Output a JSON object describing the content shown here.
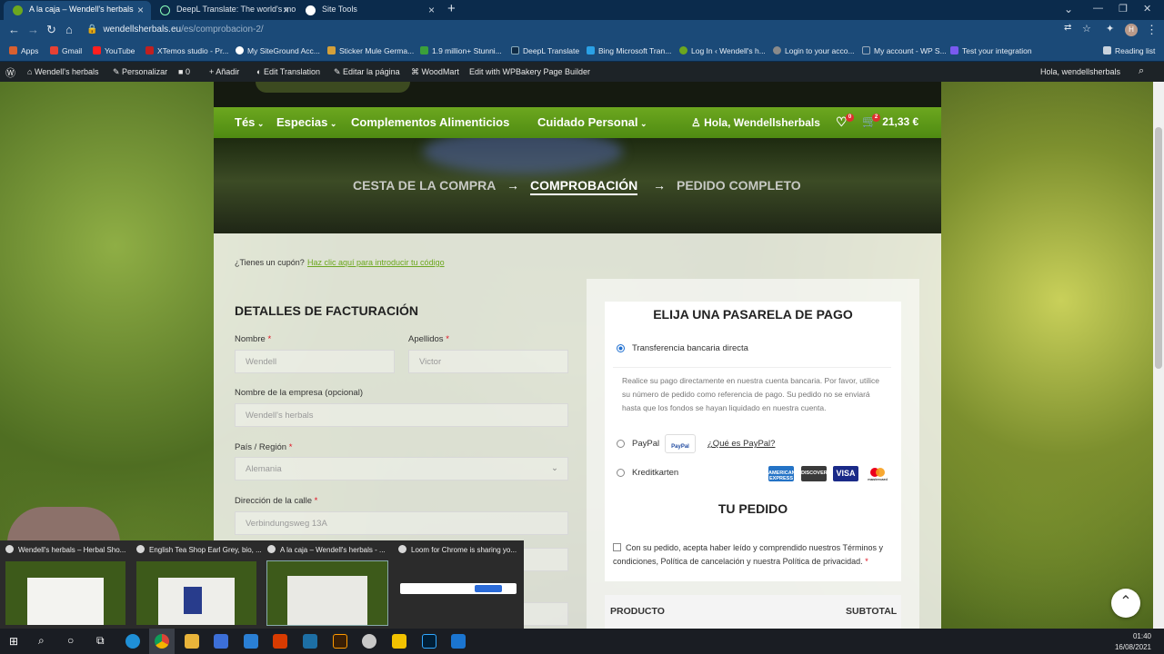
{
  "browser": {
    "tabs": [
      {
        "title": "A la caja – Wendell's herbals"
      },
      {
        "title": "DeepL Translate: The world's mo"
      },
      {
        "title": "Site Tools"
      }
    ],
    "new_tab_icon": "plus-icon",
    "url_host": "wendellsherbals.eu",
    "url_path": "/es/comprobacion-2/",
    "bookmarks": [
      "Apps",
      "Gmail",
      "YouTube",
      "XTemos studio - Pr...",
      "My SiteGround Acc...",
      "Sticker Mule Germa...",
      "1.9 million+ Stunni...",
      "DeepL Translate",
      "Bing Microsoft Tran...",
      "Log In ‹ Wendell's h...",
      "Login to your acco...",
      "My account - WP S...",
      "Test your integration"
    ],
    "reading_list": "Reading list",
    "avatar_letter": "H"
  },
  "adminbar": {
    "site": "Wendell's herbals",
    "customize": "Personalizar",
    "comments": "0",
    "add": "Añadir",
    "translate": "Edit Translation",
    "edit_page": "Editar la página",
    "woodmart": "WoodMart",
    "wpbakery": "Edit with WPBakery Page Builder",
    "greeting": "Hola, wendellsherbals"
  },
  "menu": {
    "items": [
      "Tés",
      "Especias",
      "Complementos Alimenticios",
      "Cuidado Personal"
    ],
    "account": "Hola, Wendellsherbals",
    "wishlist_count": "0",
    "cart_count": "2",
    "cart_total": "21,33 €"
  },
  "steps": [
    "CESTA DE LA COMPRA",
    "COMPROBACIÓN",
    "PEDIDO COMPLETO"
  ],
  "coupon": {
    "question": "¿Tienes un cupón?",
    "link": "Haz clic aquí para introducir tu código"
  },
  "billing": {
    "title": "DETALLES DE FACTURACIÓN",
    "first_name_label": "Nombre",
    "first_name_value": "Wendell",
    "last_name_label": "Apellidos",
    "last_name_value": "Victor",
    "company_label": "Nombre de la empresa (opcional)",
    "company_value": "Wendell's herbals",
    "country_label": "País / Región",
    "country_value": "Alemania",
    "street_label": "Dirección de la calle",
    "street_value": "Verbindungsweg 13A",
    "required_mark": "*"
  },
  "payment": {
    "title": "ELIJA UNA PASARELA DE PAGO",
    "bank_transfer": "Transferencia bancaria directa",
    "bank_description": "Realice su pago directamente en nuestra cuenta bancaria. Por favor, utilice su número de pedido como referencia de pago. Su pedido no se enviará hasta que los fondos se hayan liquidado en nuestra cuenta.",
    "paypal": "PayPal",
    "paypal_badge": "PayPal",
    "paypal_link": "¿Qué es PayPal?",
    "credit_card": "Kreditkarten",
    "cards": [
      "AMERICAN EXPRESS",
      "DISCOVER",
      "VISA",
      "mastercard"
    ],
    "order_title": "TU PEDIDO",
    "terms": "Con su pedido, acepta haber leído y comprendido nuestros Términos y condiciones, Política de cancelación y nuestra Política de privacidad.",
    "product_header": "PRODUCTO",
    "subtotal_header": "SUBTOTAL"
  },
  "taskbar_popup": {
    "windows": [
      "Wendell's herbals – Herbal Sho...",
      "English Tea Shop Earl Grey, bio, ...",
      "A la caja – Wendell's herbals - ...",
      "Loom for Chrome is sharing yo..."
    ]
  },
  "clock": {
    "time": "01:40",
    "date": "16/08/2021"
  }
}
